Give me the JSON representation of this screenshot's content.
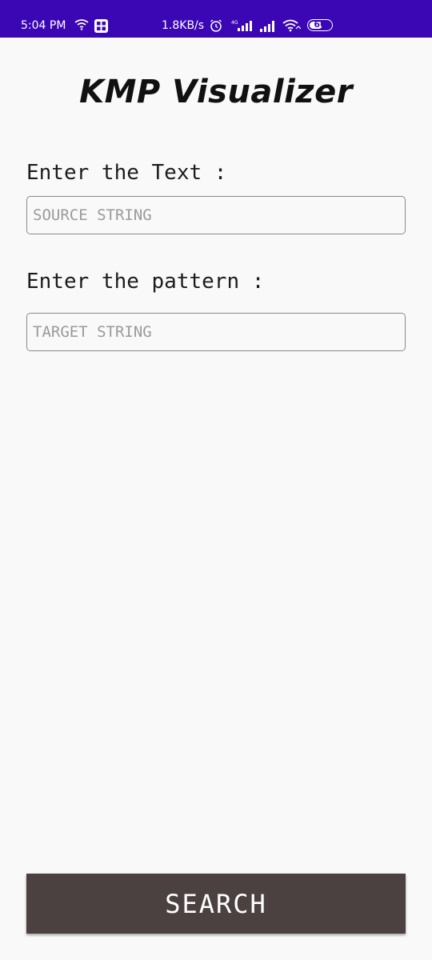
{
  "status_bar": {
    "time": "5:04 PM",
    "network_speed": "1.8KB/s",
    "battery_level": "66",
    "battery_fraction": 0.66,
    "icons": [
      "wifi-icon",
      "grid-icon",
      "alarm-icon",
      "signal-4g-icon",
      "signal-icon",
      "wifi-icon",
      "battery-icon"
    ],
    "background_color": "#3b07b5"
  },
  "app": {
    "title": "KMP Visualizer"
  },
  "form": {
    "text_label": "Enter the Text :",
    "source_placeholder": "SOURCE STRING",
    "source_value": "",
    "pattern_label": "Enter the pattern :",
    "target_placeholder": "TARGET STRING",
    "target_value": ""
  },
  "actions": {
    "search_label": "SEARCH",
    "search_color": "#4a4140"
  }
}
